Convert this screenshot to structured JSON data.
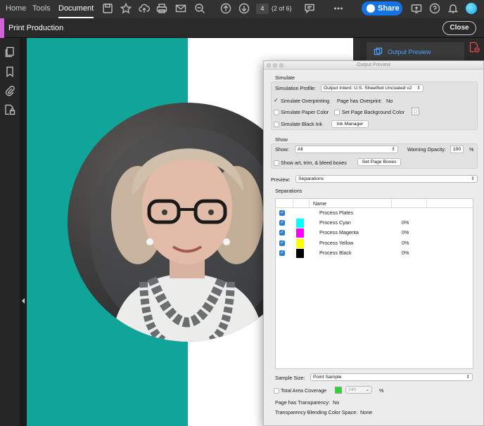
{
  "nav": {
    "home": "Home",
    "tools": "Tools",
    "document": "Document"
  },
  "pager": {
    "current": "4",
    "count": "(2 of 6)"
  },
  "share": {
    "label": "Share"
  },
  "tool": {
    "title": "Print Production",
    "close": "Close"
  },
  "right_panel": {
    "output_preview": "Output Preview"
  },
  "dialog": {
    "title": "Output Preview",
    "simulate": {
      "heading": "Simulate",
      "profile_label": "Simulation Profile:",
      "profile_value": "Output Intent: U.S. Sheetfed Uncoated v2",
      "overprinting_label": "Simulate Overprinting",
      "has_overprint_label": "Page has Overprint:",
      "has_overprint_value": "No",
      "paper_color_label": "Simulate Paper Color",
      "page_bg_label": "Set Page Background Color",
      "black_ink_label": "Simulate Black Ink",
      "ink_manager": "Ink Manager"
    },
    "show": {
      "heading": "Show",
      "show_label": "Show:",
      "show_value": "All",
      "warning_opacity_label": "Warning Opacity:",
      "warning_opacity_value": "100",
      "percent": "%",
      "art_trim_label": "Show art, trim, & bleed boxes",
      "set_page_boxes": "Set Page Boxes"
    },
    "preview_label": "Preview:",
    "preview_value": "Separations",
    "separations": {
      "heading": "Separations",
      "col_name": "Name",
      "rows": [
        {
          "name": "Process Plates",
          "value": "",
          "color": ""
        },
        {
          "name": "Process Cyan",
          "value": "0%",
          "color": "#00ffff"
        },
        {
          "name": "Process Magenta",
          "value": "0%",
          "color": "#ff00ff"
        },
        {
          "name": "Process Yellow",
          "value": "0%",
          "color": "#ffff00"
        },
        {
          "name": "Process Black",
          "value": "0%",
          "color": "#000000"
        }
      ]
    },
    "sample_size_label": "Sample Size:",
    "sample_size_value": "Point Sample",
    "total_area_label": "Total Area Coverage",
    "total_area_value": "240",
    "total_area_color": "#22dd22",
    "total_area_percent": "%",
    "transparency_label": "Page has Transparency:",
    "transparency_value": "No",
    "blending_label": "Transparency Blending Color Space:",
    "blending_value": "None"
  },
  "colors": {
    "accent": "#1473e6",
    "teal": "#11a59a",
    "tool_accent": "#d460d8"
  }
}
